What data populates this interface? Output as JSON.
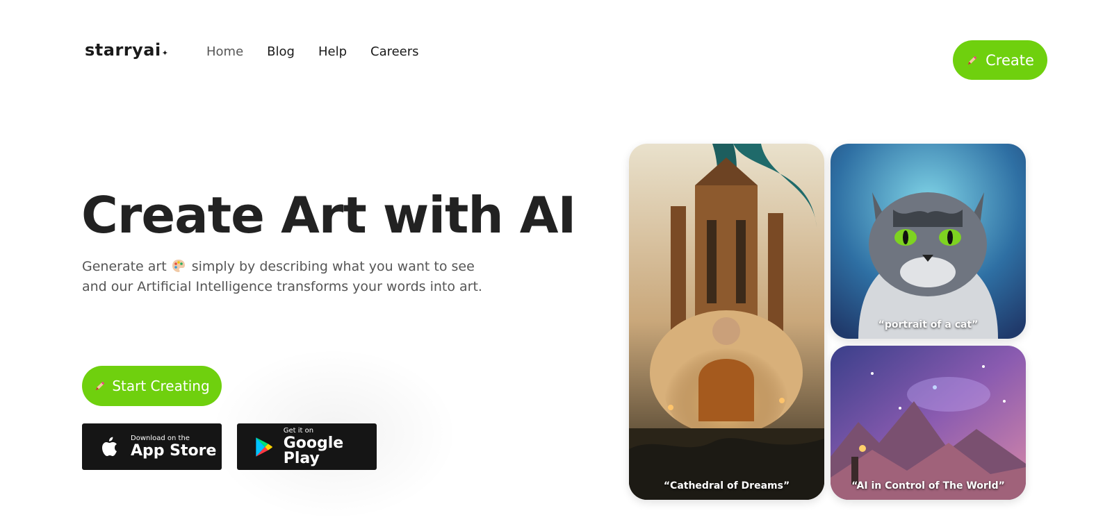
{
  "header": {
    "logo": "starryai",
    "nav": [
      "Home",
      "Blog",
      "Help",
      "Careers"
    ],
    "create_label": "Create"
  },
  "hero": {
    "title": "Create Art with AI",
    "subtitle_part1": "Generate art",
    "subtitle_part2": "simply by describing what you want to see",
    "subtitle_line2": "and our Artificial Intelligence transforms your words into art.",
    "start_label": "Start Creating"
  },
  "stores": {
    "apple_small": "Download on the",
    "apple_big": "App Store",
    "google_small": "Get it on",
    "google_big": "Google Play"
  },
  "gallery": {
    "cathedral_caption": "“Cathedral of Dreams”",
    "cat_caption": "“portrait of a cat”",
    "space_caption": "“AI in Control of The World”"
  },
  "colors": {
    "accent": "#6fd00e",
    "store_bg": "#151515"
  },
  "icons": [
    "pencil-icon",
    "palette-icon",
    "apple-icon",
    "google-play-icon"
  ]
}
